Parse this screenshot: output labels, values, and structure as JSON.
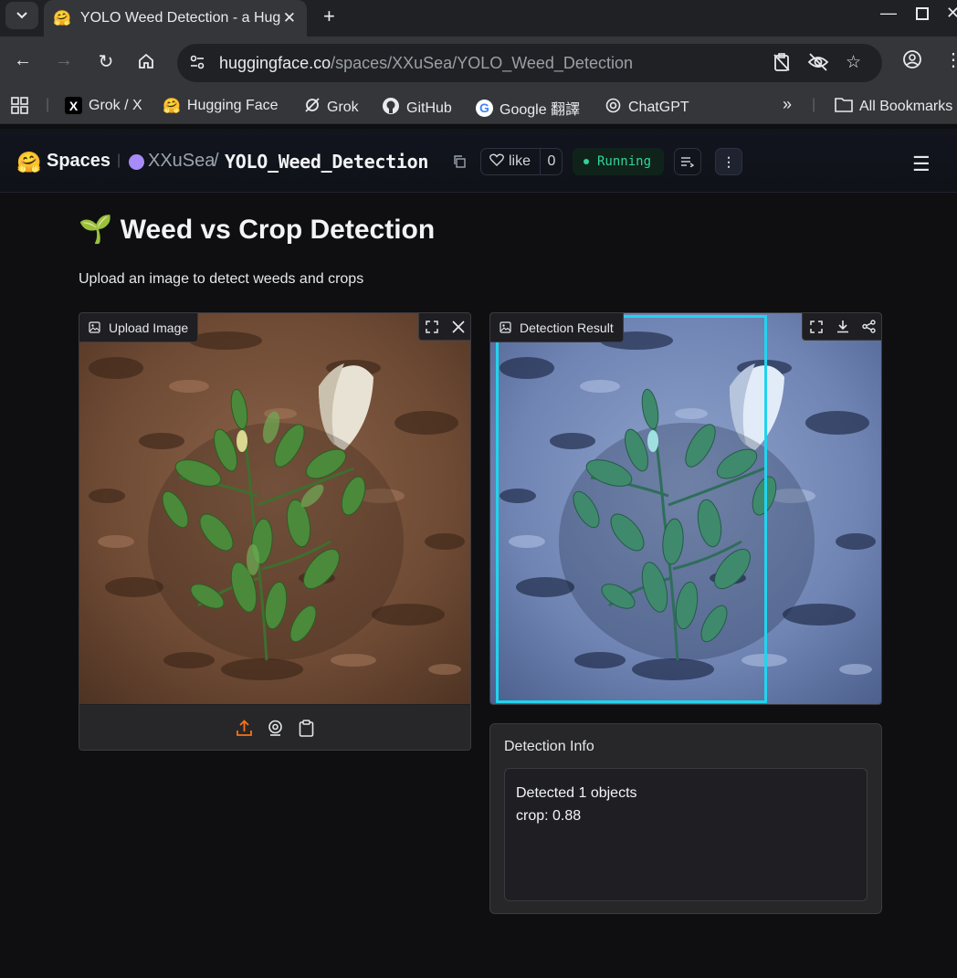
{
  "browser": {
    "tab_title": "YOLO Weed Detection - a Hugging Face Space",
    "url_host": "huggingface.co",
    "url_path": "/spaces/XXuSea/YOLO_Weed_Detection",
    "bookmarks": [
      {
        "label": "Grok / X",
        "icon": "x-logo-icon"
      },
      {
        "label": "Hugging Face",
        "icon": "hugging-face-icon"
      },
      {
        "label": "Grok",
        "icon": "grok-icon"
      },
      {
        "label": "GitHub",
        "icon": "github-icon"
      },
      {
        "label": "Google 翻譯",
        "icon": "google-icon"
      },
      {
        "label": "ChatGPT",
        "icon": "openai-icon"
      }
    ],
    "more_bookmarks": "»",
    "all_bookmarks": "All Bookmarks"
  },
  "space": {
    "brand": "Spaces",
    "owner": "XXuSea",
    "separator": "/",
    "repo": "YOLO_Weed_Detection",
    "like_label": "like",
    "like_count": "0",
    "status": "Running"
  },
  "app": {
    "title": "🌱 Weed vs Crop Detection",
    "description": "Upload an image to detect weeds and crops",
    "upload_label": "Upload Image",
    "result_label": "Detection Result",
    "info_label": "Detection Info",
    "info_lines": [
      "Detected 1 objects",
      "crop: 0.88"
    ],
    "detections": [
      {
        "class": "crop",
        "confidence": 0.88
      }
    ]
  },
  "colors": {
    "accent_orange": "#f97316",
    "bbox_cyan": "#22d3ee",
    "running_green": "#34d399",
    "owner_dot": "#a78bfa"
  }
}
